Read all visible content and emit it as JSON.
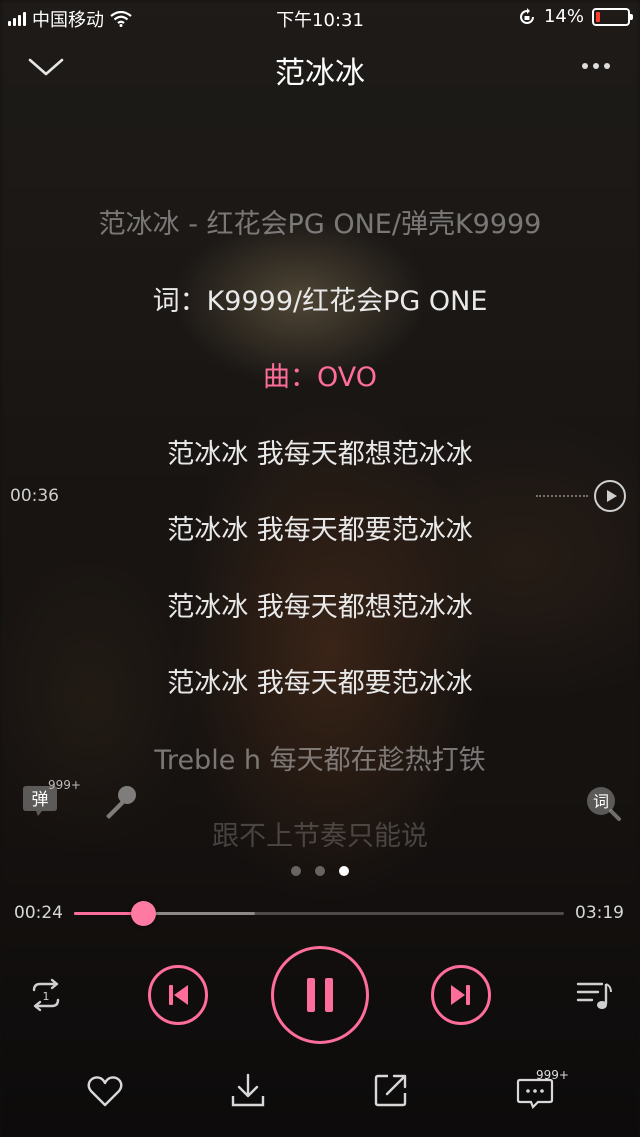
{
  "status_bar": {
    "carrier": "中国移动",
    "time": "下午10:31",
    "battery_text": "14%",
    "battery_level": 0.14
  },
  "header": {
    "title": "范冰冰"
  },
  "lyrics": [
    {
      "text": "范冰冰 - 红花会PG ONE/弹壳K9999",
      "state": "dim"
    },
    {
      "text": "词：K9999/红花会PG ONE",
      "state": "normal"
    },
    {
      "text": "曲：OVO",
      "state": "active"
    },
    {
      "text": "范冰冰 我每天都想范冰冰",
      "state": "normal"
    },
    {
      "text": "范冰冰 我每天都要范冰冰",
      "state": "normal"
    },
    {
      "text": "范冰冰 我每天都想范冰冰",
      "state": "normal"
    },
    {
      "text": "范冰冰 我每天都要范冰冰",
      "state": "normal"
    },
    {
      "text": "Treble h 每天都在趁热打铁",
      "state": "dim"
    },
    {
      "text": "跟不上节奏只能说",
      "state": "fade"
    }
  ],
  "seek_preview": {
    "time": "00:36"
  },
  "side": {
    "danmu_label": "弹",
    "danmu_badge": "999+",
    "lyric_toggle_label": "词"
  },
  "pager": {
    "count": 3,
    "active": 2
  },
  "progress": {
    "current": "00:24",
    "total": "03:19",
    "played_fraction": 0.14,
    "buffered_fraction": 0.37
  },
  "bottom": {
    "comment_badge": "999+"
  },
  "colors": {
    "accent": "#ff6d9a",
    "background": "#1e1916"
  },
  "icons": {
    "header_left": "chevron-down-icon",
    "header_right": "more-icon",
    "repeat": "repeat-one-icon",
    "prev": "skip-previous-icon",
    "play": "pause-icon",
    "next": "skip-next-icon",
    "playlist": "playlist-icon",
    "like": "heart-icon",
    "download": "download-icon",
    "share": "share-icon",
    "comment": "comment-icon",
    "mic": "microphone-icon"
  }
}
